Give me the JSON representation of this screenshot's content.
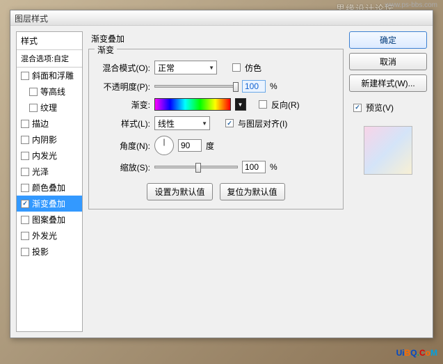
{
  "watermark": {
    "top1": "思缘设计论坛",
    "top2": "www.ps-bbs.com"
  },
  "dialog": {
    "title": "图层样式",
    "left": {
      "header": "样式",
      "blend_opts": "混合选项:自定",
      "items": [
        {
          "label": "斜面和浮雕",
          "checked": false,
          "indent": false
        },
        {
          "label": "等高线",
          "checked": false,
          "indent": true
        },
        {
          "label": "纹理",
          "checked": false,
          "indent": true
        },
        {
          "label": "描边",
          "checked": false,
          "indent": false
        },
        {
          "label": "内阴影",
          "checked": false,
          "indent": false
        },
        {
          "label": "内发光",
          "checked": false,
          "indent": false
        },
        {
          "label": "光泽",
          "checked": false,
          "indent": false
        },
        {
          "label": "颜色叠加",
          "checked": false,
          "indent": false
        },
        {
          "label": "渐变叠加",
          "checked": true,
          "indent": false,
          "selected": true
        },
        {
          "label": "图案叠加",
          "checked": false,
          "indent": false
        },
        {
          "label": "外发光",
          "checked": false,
          "indent": false
        },
        {
          "label": "投影",
          "checked": false,
          "indent": false
        }
      ]
    },
    "center": {
      "group_title": "渐变叠加",
      "fieldset_legend": "渐变",
      "blend_mode_label": "混合模式(O):",
      "blend_mode_value": "正常",
      "dither_label": "仿色",
      "opacity_label": "不透明度(P):",
      "opacity_value": "100",
      "percent": "%",
      "gradient_label": "渐变:",
      "reverse_label": "反向(R)",
      "style_label": "样式(L):",
      "style_value": "线性",
      "align_label": "与图层对齐(I)",
      "angle_label": "角度(N):",
      "angle_value": "90",
      "angle_unit": "度",
      "scale_label": "缩放(S):",
      "scale_value": "100",
      "btn_default": "设置为默认值",
      "btn_reset": "复位为默认值"
    },
    "right": {
      "ok": "确定",
      "cancel": "取消",
      "new_style": "新建样式(W)...",
      "preview_label": "预览(V)"
    }
  },
  "brand": {
    "u": "U",
    "i": "i",
    "b": "B",
    "q": "Q",
    "dot": ".",
    "c": "C",
    "o": "o",
    "m": "M"
  }
}
